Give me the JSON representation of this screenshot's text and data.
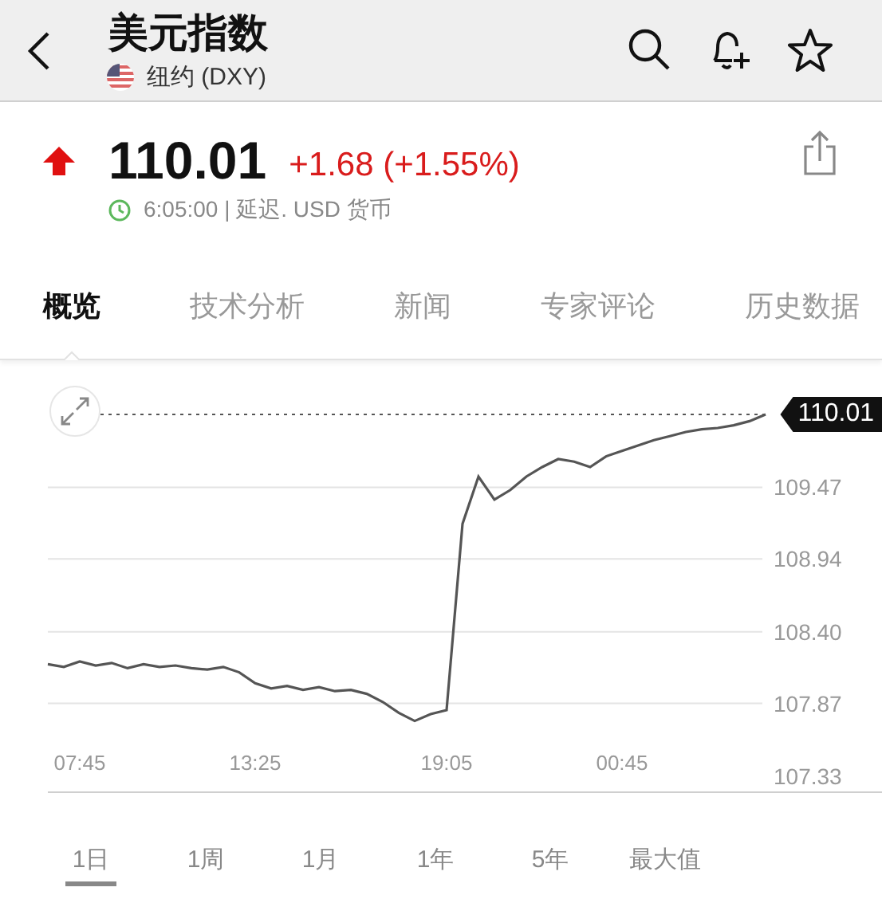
{
  "header": {
    "title": "美元指数",
    "exchange": "纽约 (DXY)"
  },
  "quote": {
    "rising": true,
    "price": "110.01",
    "change": "+1.68 (+1.55%)",
    "status": "6:05:00 | 延迟. USD 货币"
  },
  "tabs": [
    {
      "label": "概览",
      "selected": true
    },
    {
      "label": "技术分析",
      "selected": false
    },
    {
      "label": "新闻",
      "selected": false
    },
    {
      "label": "专家评论",
      "selected": false
    },
    {
      "label": "历史数据",
      "selected": false
    }
  ],
  "chart": {
    "last_price_tag": "110.01",
    "chart_data": {
      "type": "line",
      "categories": [
        null,
        null,
        "07:45",
        null,
        null,
        null,
        null,
        null,
        null,
        null,
        null,
        null,
        null,
        "13:25",
        null,
        null,
        null,
        null,
        null,
        null,
        null,
        null,
        null,
        null,
        null,
        "19:05",
        null,
        null,
        null,
        null,
        null,
        null,
        null,
        null,
        null,
        null,
        "00:45",
        null,
        null,
        null,
        null,
        null,
        null,
        null,
        null,
        null
      ],
      "series": [
        {
          "color": "#555555",
          "values": [
            108.16,
            108.14,
            108.18,
            108.15,
            108.17,
            108.13,
            108.16,
            108.14,
            108.15,
            108.13,
            108.12,
            108.14,
            108.1,
            108.02,
            107.98,
            108.0,
            107.97,
            107.99,
            107.96,
            107.97,
            107.94,
            107.88,
            107.8,
            107.74,
            107.79,
            107.82,
            109.2,
            109.55,
            109.38,
            109.45,
            109.55,
            109.62,
            109.68,
            109.66,
            109.62,
            109.7,
            109.74,
            109.78,
            109.82,
            109.85,
            109.88,
            109.9,
            109.91,
            109.93,
            109.96,
            110.01
          ]
        }
      ],
      "ylim": [
        107.33,
        110.01
      ],
      "grid": true,
      "yticks": [
        {
          "value": 109.47,
          "label": "109.47"
        },
        {
          "value": 108.94,
          "label": "108.94"
        },
        {
          "value": 108.4,
          "label": "108.40"
        },
        {
          "value": 107.87,
          "label": "107.87"
        },
        {
          "value": 107.33,
          "label": "107.33"
        }
      ]
    }
  },
  "ranges": [
    {
      "label": "1日",
      "selected": true
    },
    {
      "label": "1周",
      "selected": false
    },
    {
      "label": "1月",
      "selected": false
    },
    {
      "label": "1年",
      "selected": false
    },
    {
      "label": "5年",
      "selected": false
    },
    {
      "label": "最大值",
      "selected": false
    }
  ]
}
